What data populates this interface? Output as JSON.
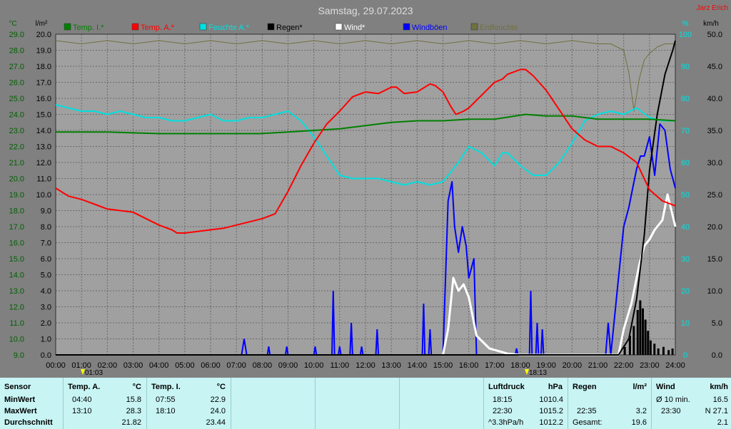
{
  "title": "Samstag, 29.07.2023",
  "author": "Jarz Erich",
  "units": {
    "temp": "°C",
    "rain": "l/m²",
    "humidity": "%",
    "wind": "km/h"
  },
  "legend": [
    {
      "label": "Temp. I.*",
      "color": "#008000"
    },
    {
      "label": "Temp. A.*",
      "color": "#ff0000"
    },
    {
      "label": "Feuchte A.*",
      "color": "#00e0e0"
    },
    {
      "label": "Regen*",
      "color": "#000000"
    },
    {
      "label": "Wind*",
      "color": "#ffffff"
    },
    {
      "label": "Windböen",
      "color": "#0000ff"
    },
    {
      "label": "Erdfeuchte",
      "color": "#707040"
    }
  ],
  "marker_labels": [
    "01:03",
    "18:13"
  ],
  "chart_data": {
    "type": "line",
    "x_ticks": [
      "00:00",
      "01:00",
      "02:00",
      "03:00",
      "04:00",
      "05:00",
      "06:00",
      "07:00",
      "08:00",
      "09:00",
      "10:00",
      "11:00",
      "12:00",
      "13:00",
      "14:00",
      "15:00",
      "16:00",
      "17:00",
      "18:00",
      "19:00",
      "20:00",
      "21:00",
      "22:00",
      "23:00",
      "24:00"
    ],
    "temp_ticks": [
      "9.0",
      "10.0",
      "11.0",
      "12.0",
      "13.0",
      "14.0",
      "15.0",
      "16.0",
      "17.0",
      "18.0",
      "19.0",
      "20.0",
      "21.0",
      "22.0",
      "23.0",
      "24.0",
      "25.0",
      "26.0",
      "27.0",
      "28.0",
      "29.0"
    ],
    "rain_ticks": [
      "0.0",
      "1.0",
      "2.0",
      "3.0",
      "4.0",
      "5.0",
      "6.0",
      "7.0",
      "8.0",
      "9.0",
      "10.0",
      "11.0",
      "12.0",
      "13.0",
      "14.0",
      "15.0",
      "16.0",
      "17.0",
      "18.0",
      "19.0",
      "20.0"
    ],
    "humidity_ticks": [
      "0",
      "10",
      "20",
      "30",
      "40",
      "50",
      "60",
      "70",
      "80",
      "90",
      "100"
    ],
    "wind_ticks": [
      "0.0",
      "5.0",
      "10.0",
      "15.0",
      "20.0",
      "25.0",
      "30.0",
      "35.0",
      "40.0",
      "45.0",
      "50.0"
    ],
    "ylim_temp": [
      9,
      29
    ],
    "ylim_rain": [
      0,
      20
    ],
    "ylim_humidity": [
      0,
      100
    ],
    "ylim_wind": [
      0,
      50
    ],
    "grid": true,
    "series": [
      {
        "name": "Temp. A.*",
        "color": "#ff0000",
        "axis": "temp",
        "x": [
          0,
          0.5,
          1,
          1.5,
          2,
          2.5,
          3,
          3.5,
          4,
          4.5,
          4.7,
          5,
          5.5,
          6,
          6.5,
          7,
          7.5,
          8,
          8.5,
          9,
          9.5,
          10,
          10.5,
          11,
          11.5,
          12,
          12.5,
          13,
          13.2,
          13.5,
          14,
          14.5,
          14.7,
          15,
          15.3,
          15.5,
          15.8,
          16,
          16.5,
          17,
          17.3,
          17.5,
          18,
          18.2,
          18.5,
          19,
          19.5,
          20,
          20.5,
          21,
          21.5,
          22,
          22.5,
          23,
          23.5,
          24
        ],
        "y": [
          19.4,
          18.9,
          18.7,
          18.4,
          18.1,
          18.0,
          17.9,
          17.5,
          17.1,
          16.8,
          16.6,
          16.6,
          16.7,
          16.8,
          16.9,
          17.1,
          17.3,
          17.5,
          17.8,
          19.2,
          20.8,
          22.2,
          23.4,
          24.2,
          25.1,
          25.4,
          25.3,
          25.7,
          25.7,
          25.3,
          25.4,
          25.9,
          25.8,
          25.4,
          24.5,
          24.0,
          24.2,
          24.4,
          25.2,
          26.0,
          26.2,
          26.5,
          26.8,
          26.8,
          26.4,
          25.5,
          24.3,
          23.1,
          22.4,
          22.0,
          22.0,
          21.6,
          21.0,
          19.3,
          18.6,
          18.3
        ]
      },
      {
        "name": "Temp. I.*",
        "color": "#008000",
        "axis": "temp",
        "x": [
          0,
          2,
          4,
          6,
          7.9,
          9,
          10,
          11,
          12,
          13,
          14,
          15,
          16,
          17,
          18.2,
          19,
          20,
          21,
          22,
          23,
          24
        ],
        "y": [
          22.9,
          22.9,
          22.8,
          22.8,
          22.8,
          22.9,
          23.0,
          23.1,
          23.3,
          23.5,
          23.6,
          23.6,
          23.7,
          23.7,
          24.0,
          23.9,
          23.9,
          23.7,
          23.7,
          23.7,
          23.6
        ]
      },
      {
        "name": "Feuchte A.*",
        "color": "#00e0e0",
        "axis": "humidity",
        "x": [
          0,
          0.5,
          1,
          1.5,
          2,
          2.5,
          3,
          3.5,
          4,
          4.5,
          5,
          5.5,
          6,
          6.5,
          7,
          7.5,
          8,
          8.5,
          9,
          9.5,
          10,
          10.5,
          11,
          11.5,
          12,
          12.5,
          13,
          13.5,
          14,
          14.5,
          15,
          15.3,
          15.6,
          16,
          16.5,
          17,
          17.3,
          17.5,
          18,
          18.5,
          19,
          19.5,
          20,
          20.5,
          21,
          21.5,
          22,
          22.5,
          23,
          23.5,
          24
        ],
        "y": [
          78,
          77,
          76,
          76,
          75,
          76,
          75,
          74,
          74,
          73,
          73,
          74,
          75,
          73,
          73,
          74,
          74,
          75,
          76,
          73,
          68,
          62,
          56,
          55,
          55,
          55,
          54,
          53,
          54,
          53,
          54,
          57,
          60,
          65,
          63,
          59,
          63,
          63,
          59,
          56,
          56,
          60,
          66,
          73,
          75,
          76,
          75,
          77,
          74,
          73,
          73
        ]
      },
      {
        "name": "Erdfeuchte",
        "color": "#707040",
        "axis": "humidity",
        "x": [
          0,
          1,
          2,
          3,
          4,
          5,
          6,
          7,
          8,
          9,
          10,
          11,
          12,
          13,
          14,
          15,
          16,
          17,
          18,
          19,
          20,
          21,
          21.5,
          22,
          22.2,
          22.4,
          22.6,
          22.8,
          23,
          23.3,
          23.6,
          24
        ],
        "y": [
          98,
          97,
          98,
          97,
          98,
          97,
          98,
          97,
          98,
          97,
          98,
          97,
          98,
          97,
          98,
          97,
          98,
          97,
          98,
          97,
          98,
          97,
          97,
          95,
          88,
          76,
          86,
          92,
          94,
          96,
          97,
          97
        ]
      },
      {
        "name": "Regen*",
        "color": "#000000",
        "axis": "rain",
        "x": [
          0,
          21.8,
          22.2,
          22.5,
          22.8,
          23.0,
          23.3,
          23.6,
          23.9,
          24
        ],
        "y": [
          0,
          0,
          1.0,
          3.5,
          7.5,
          11.5,
          15.0,
          17.5,
          19.0,
          19.6
        ]
      },
      {
        "name": "Wind*",
        "color": "#ffffff",
        "axis": "wind",
        "x": [
          15,
          15.2,
          15.4,
          15.6,
          15.8,
          16,
          16.3,
          16.8,
          17.5,
          18,
          21.8,
          22,
          22.3,
          22.6,
          22.8,
          23,
          23.2,
          23.5,
          23.7,
          24
        ],
        "y": [
          0,
          4,
          12,
          10,
          11,
          9,
          3,
          1,
          0.2,
          0,
          0,
          4,
          8,
          14,
          17,
          18,
          19.5,
          21,
          25,
          20
        ]
      },
      {
        "name": "Windböen",
        "color": "#0000ff",
        "axis": "wind",
        "bars": [
          [
            7.2,
            7.4,
            2.5
          ],
          [
            8.2,
            8.3,
            1.3
          ],
          [
            8.9,
            9.0,
            1.3
          ],
          [
            10.0,
            10.1,
            1.3
          ],
          [
            10.7,
            10.8,
            10.0
          ],
          [
            10.95,
            11.05,
            1.3
          ],
          [
            11.4,
            11.5,
            5.0
          ],
          [
            11.8,
            11.9,
            1.3
          ],
          [
            12.4,
            12.5,
            4.0
          ],
          [
            14.2,
            14.3,
            8.0
          ],
          [
            14.45,
            14.55,
            4.0
          ],
          [
            17.8,
            17.9,
            1.0
          ],
          [
            18.35,
            18.45,
            10.0
          ],
          [
            18.6,
            18.7,
            5.0
          ],
          [
            18.8,
            18.9,
            4.0
          ],
          [
            21.3,
            21.5,
            5.0
          ]
        ],
        "x": [
          15,
          15.2,
          15.35,
          15.45,
          15.6,
          15.75,
          15.9,
          16,
          16.2,
          16.3,
          21.5,
          21.8,
          22,
          22.2,
          22.35,
          22.5,
          22.65,
          22.8,
          23,
          23.2,
          23.4,
          23.6,
          23.8,
          24
        ],
        "y": [
          0,
          24,
          27,
          20,
          16,
          20,
          17,
          12,
          15,
          0,
          0,
          12,
          20,
          23,
          26,
          29,
          31,
          31,
          34,
          28,
          36,
          35,
          29,
          26
        ]
      }
    ]
  },
  "stats": {
    "sensor": {
      "header": "Sensor",
      "rows": [
        "MinWert",
        "MaxWert",
        "Durchschnitt"
      ]
    },
    "temp_a": {
      "header": "Temp. A.",
      "unit": "°C",
      "rows": [
        [
          "04:40",
          "15.8"
        ],
        [
          "13:10",
          "28.3"
        ],
        [
          "",
          "21.82"
        ]
      ]
    },
    "temp_i": {
      "header": "Temp. I.",
      "unit": "°C",
      "rows": [
        [
          "07:55",
          "22.9"
        ],
        [
          "18:10",
          "24.0"
        ],
        [
          "",
          "23.44"
        ]
      ]
    },
    "pressure": {
      "header": "Luftdruck",
      "unit": "hPa",
      "rows": [
        [
          "18:15",
          "1010.4"
        ],
        [
          "22:30",
          "1015.2"
        ],
        [
          "^3.3hPa/h",
          "1012.2"
        ]
      ]
    },
    "rain": {
      "header": "Regen",
      "unit": "l/m²",
      "rows": [
        [
          "",
          ""
        ],
        [
          "22:35",
          "3.2"
        ],
        [
          "Gesamt:",
          "19.6"
        ]
      ]
    },
    "wind": {
      "header": "Wind",
      "unit": "km/h",
      "rows": [
        [
          "Ø 10 min.",
          "16.5"
        ],
        [
          "23:30",
          "N 27.1"
        ],
        [
          "",
          "2.1"
        ]
      ]
    }
  }
}
